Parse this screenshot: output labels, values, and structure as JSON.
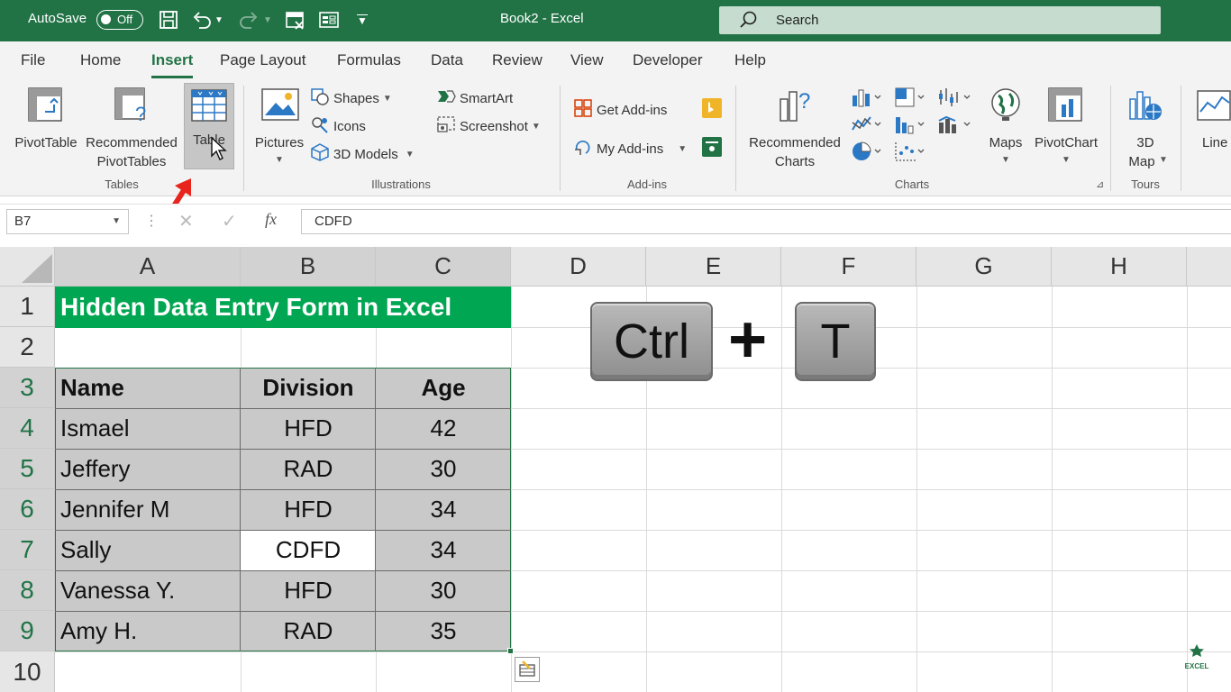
{
  "titlebar": {
    "autosave_label": "AutoSave",
    "autosave_state": "Off",
    "doc_title": "Book2  -  Excel",
    "search_placeholder": "Search"
  },
  "menu": {
    "tabs": [
      "File",
      "Home",
      "Insert",
      "Page Layout",
      "Formulas",
      "Data",
      "Review",
      "View",
      "Developer",
      "Help"
    ],
    "active_tab": "Insert"
  },
  "ribbon": {
    "tables": {
      "pivottable": "PivotTable",
      "recommended_line1": "Recommended",
      "recommended_line2": "PivotTables",
      "table": "Table",
      "group": "Tables"
    },
    "illustrations": {
      "pictures": "Pictures",
      "shapes": "Shapes",
      "icons": "Icons",
      "models": "3D Models",
      "smartart": "SmartArt",
      "screenshot": "Screenshot",
      "group": "Illustrations"
    },
    "addins": {
      "get": "Get Add-ins",
      "my": "My Add-ins",
      "group": "Add-ins"
    },
    "charts": {
      "recommended_line1": "Recommended",
      "recommended_line2": "Charts",
      "maps": "Maps",
      "pivotchart": "PivotChart",
      "group": "Charts"
    },
    "tours": {
      "map_line1": "3D",
      "map_line2": "Map",
      "group": "Tours"
    },
    "line": "Line"
  },
  "formula_bar": {
    "name_box": "B7",
    "fx": "fx",
    "content": "CDFD"
  },
  "sheet": {
    "columns": [
      "A",
      "B",
      "C",
      "D",
      "E",
      "F",
      "G",
      "H"
    ],
    "rows": [
      "1",
      "2",
      "3",
      "4",
      "5",
      "6",
      "7",
      "8",
      "9",
      "10"
    ],
    "title": "Hidden Data Entry Form in Excel",
    "headers": [
      "Name",
      "Division",
      "Age"
    ],
    "data": [
      [
        "Ismael",
        "HFD",
        "42"
      ],
      [
        "Jeffery",
        "RAD",
        "30"
      ],
      [
        "Jennifer M",
        "HFD",
        "34"
      ],
      [
        "Sally",
        "CDFD",
        "34"
      ],
      [
        "Vanessa Y.",
        "HFD",
        "30"
      ],
      [
        "Amy H.",
        "RAD",
        "35"
      ]
    ]
  },
  "shortcut": {
    "key1": "Ctrl",
    "plus": "+",
    "key2": "T"
  },
  "watermark": "EXCEL"
}
